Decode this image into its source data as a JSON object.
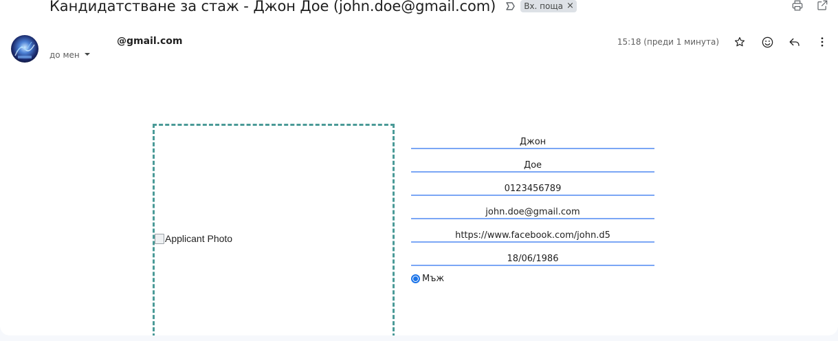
{
  "email": {
    "subject": "Кандидатстване за стаж - Джон Дое (john.doe@gmail.com)",
    "label": "Вх. поща",
    "label_remove": "×",
    "sender": "@gmail.com",
    "recipient": "до мен",
    "time": "15:18 (преди 1 минута)"
  },
  "icons": {
    "importance": "importance-marker-icon",
    "print": "printer-icon",
    "open_new_window": "open-in-new-window-icon",
    "star": "star-icon",
    "emoji": "emoji-reaction-icon",
    "reply": "reply-icon",
    "more": "more-vert-icon",
    "dropdown": "caret-down-icon"
  },
  "form": {
    "photo_alt": "Applicant Photo",
    "first_name": "Джон",
    "last_name": "Дое",
    "phone": "0123456789",
    "email": "john.doe@gmail.com",
    "facebook": "https://www.facebook.com/john.d5",
    "birth_date": "18/06/1986",
    "gender_label": "Мъж",
    "gender_selected": true
  },
  "colors": {
    "field_underline": "#7aa6f5",
    "photo_border": "#4a9a97",
    "radio_accent": "#1a73e8"
  }
}
